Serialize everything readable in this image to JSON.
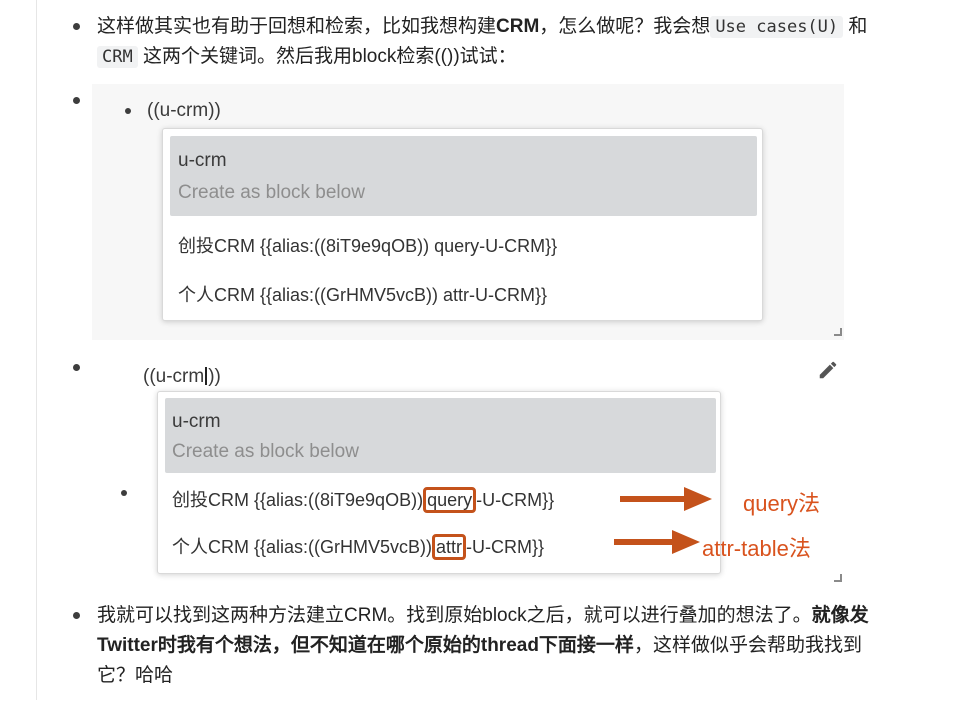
{
  "para1": {
    "t1": "这样做其实也有助于回想和检索，比如我想构建",
    "b1": "CRM",
    "t2": "，怎么做呢？我会想",
    "code1": "Use cases(U)",
    "t3": "和",
    "code2": "CRM",
    "t4": "这两个关键词。然后我用block检索(())试试："
  },
  "shot1": {
    "query": "((u-crm))",
    "popup": {
      "selected_title": "u-crm",
      "selected_sub": "Create as block below",
      "row1": "创投CRM {{alias:((8iT9e9qOB)) query-U-CRM}}",
      "row2": "个人CRM {{alias:((GrHMV5vcB)) attr-U-CRM}}"
    }
  },
  "shot2": {
    "query_before": "((u-crm",
    "query_after": "))",
    "popup": {
      "selected_title": "u-crm",
      "selected_sub": "Create as block below",
      "row1_a": "创投CRM {{alias:((8iT9e9qOB))",
      "row1_box": "query",
      "row1_b": "-U-CRM}}",
      "row2_a": "个人CRM {{alias:((GrHMV5vcB))",
      "row2_box": "attr",
      "row2_b": "-U-CRM}}"
    },
    "annot1": "query法",
    "annot2": "attr-table法",
    "accent": "#d9531e"
  },
  "para2": {
    "t1": "我就可以找到这两种方法建立CRM。找到原始block之后，就可以进行叠加的想法了。",
    "b1": "就像发Twitter时我有个想法，但不知道在哪个原始的thread下面接一样",
    "t2": "，这样做似乎会帮助我找到它？哈哈"
  },
  "icons": {
    "edit": "pencil-icon",
    "resize": "resize-handle-icon"
  }
}
